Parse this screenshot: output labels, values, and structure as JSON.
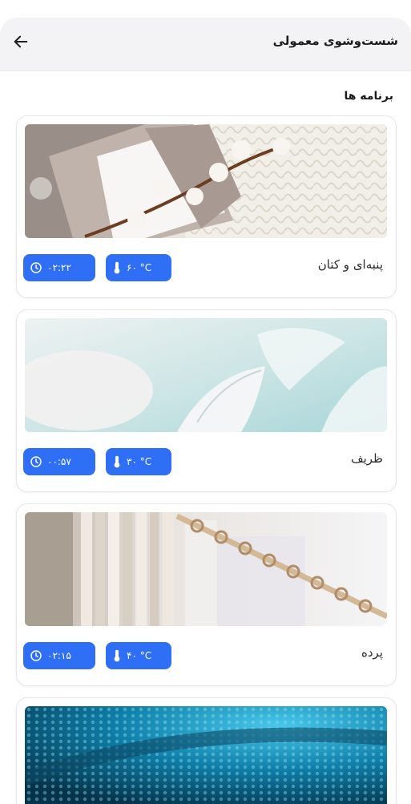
{
  "header": {
    "title": "شست‌وشوی معمولی"
  },
  "section": {
    "title": "برنامه ها"
  },
  "programs": [
    {
      "name": "پنبه‌ای و کتان",
      "duration": "۰۲:۲۲",
      "temperature": "۶۰ °C"
    },
    {
      "name": "ظریف",
      "duration": "۰۰:۵۷",
      "temperature": "۳۰ °C"
    },
    {
      "name": "پرده",
      "duration": "۰۲:۱۵",
      "temperature": "۴۰ °C"
    },
    {
      "name": "",
      "duration": "",
      "temperature": ""
    }
  ],
  "colors": {
    "accent": "#2f6ff5",
    "header_bg": "#f3f3f5"
  },
  "icons": {
    "back": "arrow-left-icon",
    "clock": "clock-icon",
    "thermometer": "thermometer-icon"
  }
}
